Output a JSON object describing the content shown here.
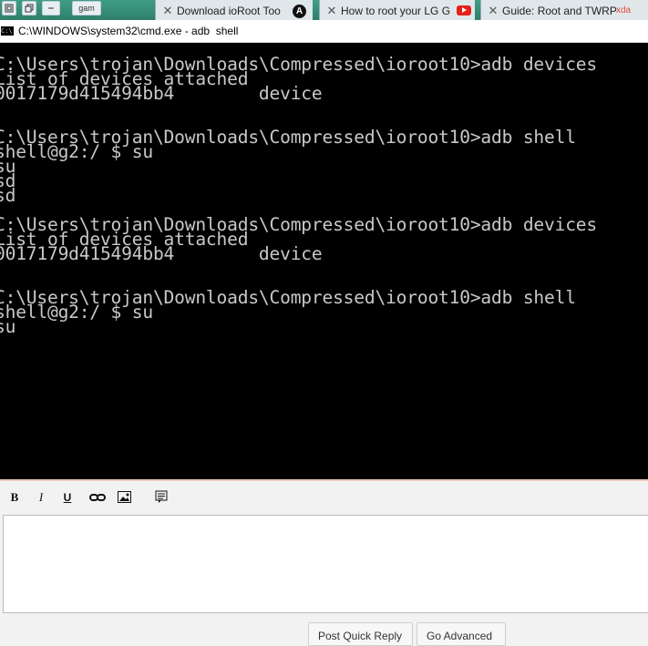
{
  "browser": {
    "toolbar_buttons": [
      {
        "icon": "window-icon"
      },
      {
        "icon": "minimize-icon"
      }
    ],
    "small_tab_label": "gam",
    "tabs": [
      {
        "label": "Download ioRoot Too",
        "badge": "A"
      },
      {
        "label": "How to root your LG G",
        "icon": "youtube-icon"
      },
      {
        "label": "Guide: Root and TWRP",
        "site_tag": "xda"
      }
    ]
  },
  "cmd_window": {
    "title": "C:\\WINDOWS\\system32\\cmd.exe - adb  shell",
    "icon_text": "C:\\"
  },
  "console": {
    "lines": [
      "C:\\Users\\trojan\\Downloads\\Compressed\\ioroot10>adb devices",
      "List of devices attached",
      "0017179d415494bb4        device",
      "",
      "",
      "C:\\Users\\trojan\\Downloads\\Compressed\\ioroot10>adb shell",
      "shell@g2:/ $ su",
      "su",
      "sd",
      "sd",
      "",
      "C:\\Users\\trojan\\Downloads\\Compressed\\ioroot10>adb devices",
      "List of devices attached",
      "0017179d415494bb4        device",
      "",
      "",
      "C:\\Users\\trojan\\Downloads\\Compressed\\ioroot10>adb shell",
      "shell@g2:/ $ su",
      "su"
    ]
  },
  "editor": {
    "toolbar": [
      {
        "name": "bold-button",
        "label": "B"
      },
      {
        "name": "italic-button",
        "label": "I"
      },
      {
        "name": "underline-button",
        "label": "U"
      },
      {
        "name": "link-button",
        "icon": "link-icon"
      },
      {
        "name": "image-button",
        "icon": "image-icon"
      },
      {
        "name": "quote-button",
        "icon": "quote-icon"
      }
    ],
    "buttons": {
      "post_quick_reply": "Post Quick Reply",
      "go_advanced": "Go Advanced"
    }
  }
}
